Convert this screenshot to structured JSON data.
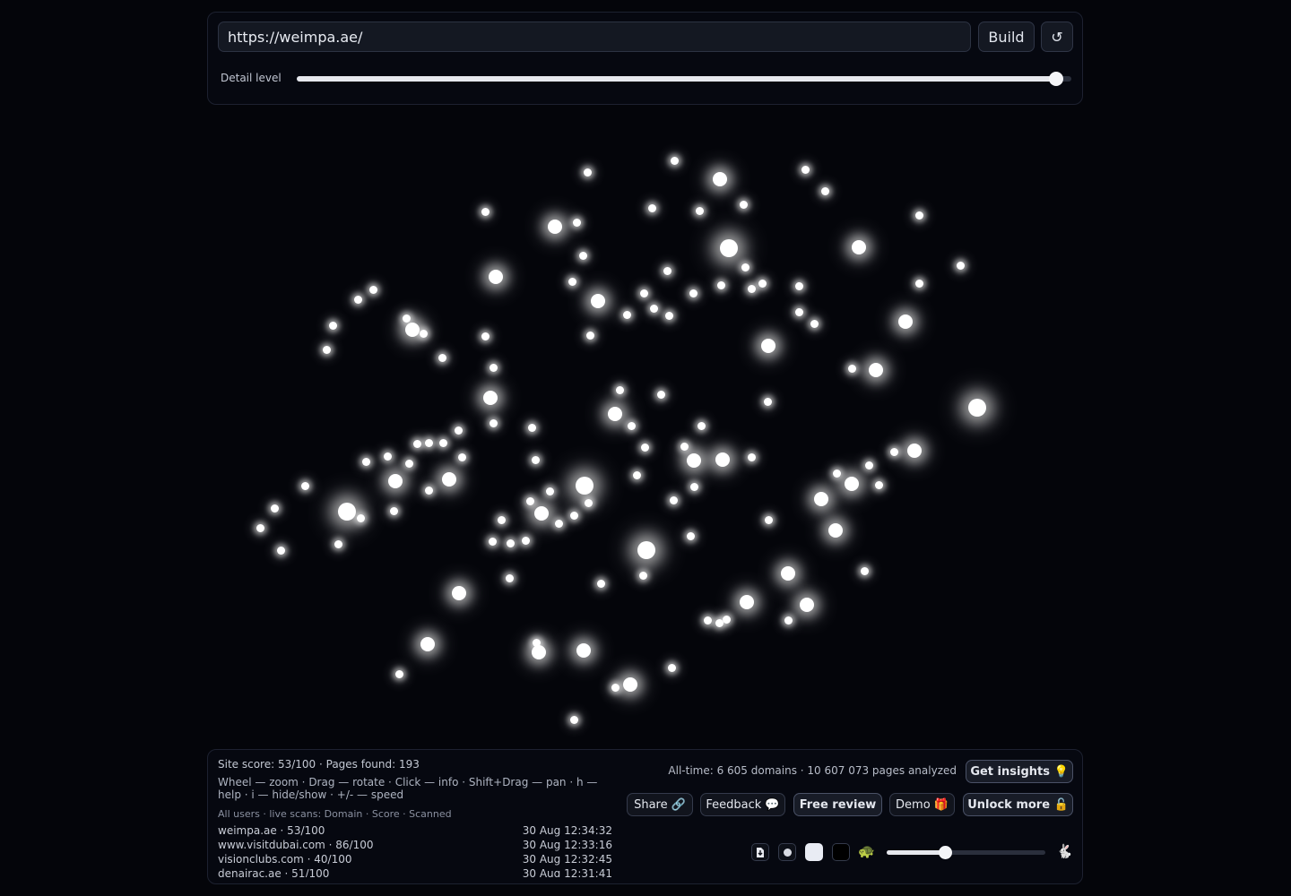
{
  "header": {
    "url_value": "https://weimpa.ae/",
    "build_label": "Build",
    "refresh_icon": "↺",
    "detail_label": "Detail level",
    "detail_level": 0.98
  },
  "footer": {
    "site_summary": "Site score: 53/100 · Pages found: 193",
    "help_text": "Wheel — zoom · Drag — rotate · Click — info · Shift+Drag — pan · h — help · i — hide/show · +/- — speed",
    "scans_header": "All users · live scans: Domain · Score · Scanned",
    "scans": [
      {
        "domain": "weimpa.ae · 53/100",
        "time": "30 Aug 12:34:32"
      },
      {
        "domain": "www.visitdubai.com · 86/100",
        "time": "30 Aug 12:33:16"
      },
      {
        "domain": "visionclubs.com · 40/100",
        "time": "30 Aug 12:32:45"
      },
      {
        "domain": "denairac.ae · 51/100",
        "time": "30 Aug 12:31:41"
      }
    ],
    "alltime": "All-time: 6 605 domains · 10 607 073 pages analyzed",
    "buttons": {
      "insights": "Get insights 💡",
      "share": "Share 🔗",
      "feedback": "Feedback 💬",
      "free_review": "Free review",
      "demo": "Demo 🎁",
      "unlock": "Unlock more 🔓"
    },
    "icons": {
      "download": "download-icon",
      "dot": "dot-style-icon",
      "light": "light-theme-icon",
      "dark": "dark-theme-icon",
      "slow": "🐢",
      "fast": "🐇"
    },
    "speed_level": 0.37
  },
  "colors": {
    "background": "#04050a",
    "panel": "#060810",
    "node": "#ffffff"
  }
}
